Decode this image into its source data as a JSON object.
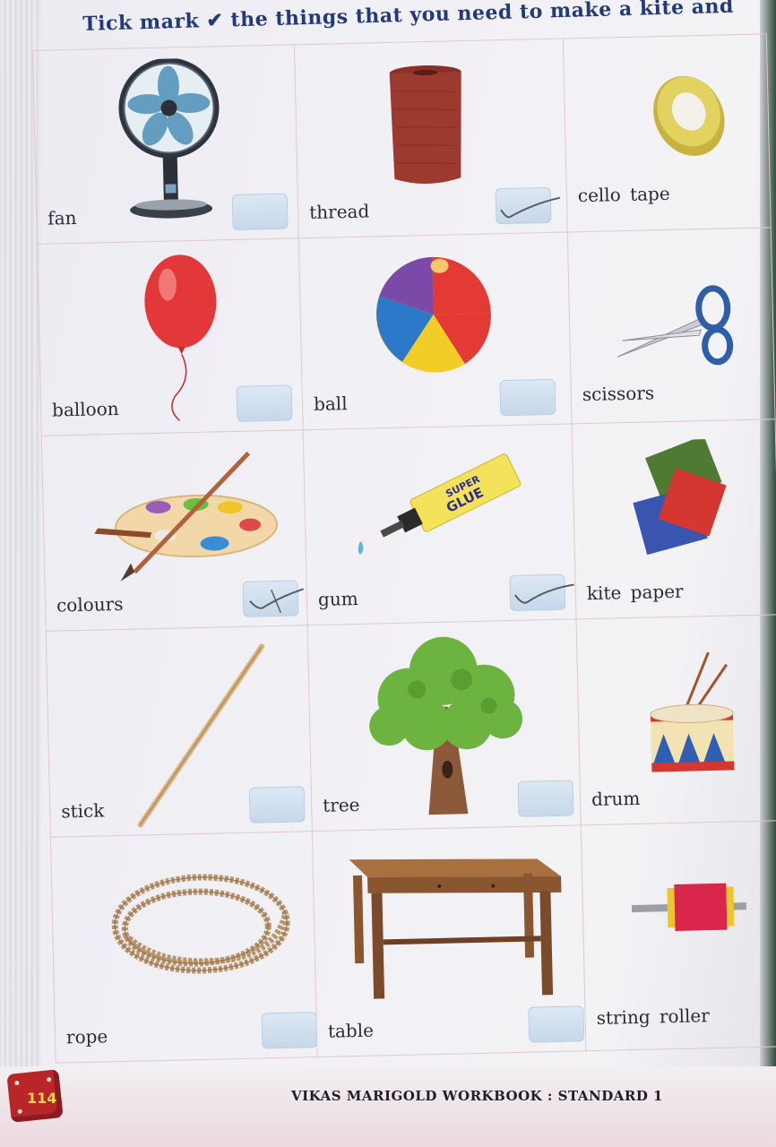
{
  "instruction": {
    "text_before": "Tick mark",
    "tick_symbol": "✔",
    "text_after": "the things that you need to make a kite and"
  },
  "items": [
    {
      "label": "fan",
      "ticked": false
    },
    {
      "label": "thread",
      "ticked": true
    },
    {
      "label": "cello  tape",
      "ticked": false
    },
    {
      "label": "balloon",
      "ticked": false
    },
    {
      "label": "ball",
      "ticked": false
    },
    {
      "label": "scissors",
      "ticked": false
    },
    {
      "label": "colours",
      "ticked": true
    },
    {
      "label": "gum",
      "ticked": true
    },
    {
      "label": "kite  paper",
      "ticked": true
    },
    {
      "label": "stick",
      "ticked": false
    },
    {
      "label": "tree",
      "ticked": false
    },
    {
      "label": "drum",
      "ticked": false
    },
    {
      "label": "rope",
      "ticked": false
    },
    {
      "label": "table",
      "ticked": false
    },
    {
      "label": "string  roller",
      "ticked": false
    }
  ],
  "glue_text": {
    "line1": "SUPER",
    "line2": "GLUE"
  },
  "footer": {
    "page_number": "114",
    "title": "VIKAS MARIGOLD WORKBOOK : STANDARD 1"
  }
}
